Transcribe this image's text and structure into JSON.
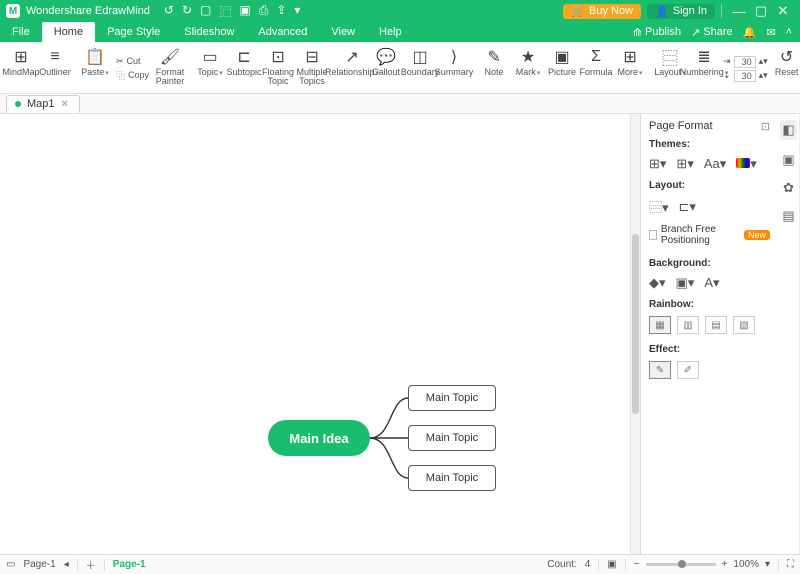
{
  "titlebar": {
    "app_name": "Wondershare EdrawMind",
    "buy_label": "Buy Now",
    "signin_label": "Sign In"
  },
  "menubar": {
    "items": [
      "File",
      "Home",
      "Page Style",
      "Slideshow",
      "Advanced",
      "View",
      "Help"
    ],
    "active_index": 1,
    "publish": "Publish",
    "share": "Share"
  },
  "ribbon": {
    "mindmap": "MindMap",
    "outliner": "Outliner",
    "paste": "Paste",
    "cut": "Cut",
    "copy": "Copy",
    "format_painter": "Format\nPainter",
    "topic": "Topic",
    "subtopic": "Subtopic",
    "floating_topic": "Floating\nTopic",
    "multiple_topics": "Multiple\nTopics",
    "relationship": "Relationship",
    "callout": "Callout",
    "boundary": "Boundary",
    "summary": "Summary",
    "note": "Note",
    "mark": "Mark",
    "picture": "Picture",
    "formula": "Formula",
    "more": "More",
    "layout": "Layout",
    "numbering": "Numbering",
    "spin1": "30",
    "spin2": "30",
    "reset": "Reset"
  },
  "tabs": {
    "map1": "Map1"
  },
  "mindmap": {
    "central": "Main Idea",
    "topics": [
      "Main Topic",
      "Main Topic",
      "Main Topic"
    ]
  },
  "panel": {
    "title": "Page Format",
    "themes": "Themes:",
    "layout": "Layout:",
    "branch_free": "Branch Free Positioning",
    "branch_badge": "New",
    "background": "Background:",
    "rainbow": "Rainbow:",
    "effect": "Effect:"
  },
  "status": {
    "page_label": "Page-1",
    "page_name": "Page-1",
    "count_label": "Count:",
    "count_value": "4",
    "zoom": "100%"
  }
}
